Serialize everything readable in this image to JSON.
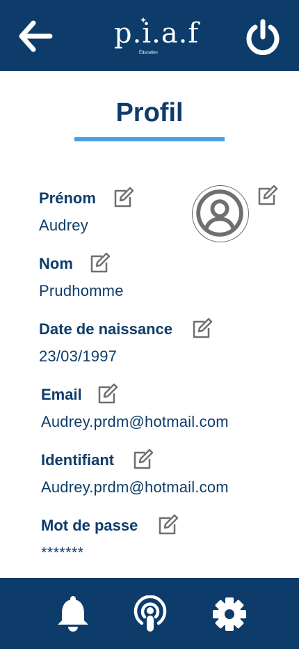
{
  "header": {
    "logo_text": "p.i.a.f",
    "logo_subtitle": "Éducation",
    "back_icon": "arrow-left-icon",
    "power_icon": "power-icon"
  },
  "page": {
    "title": "Profil"
  },
  "profile": {
    "avatar_icon": "user-circle-icon",
    "fields": [
      {
        "label": "Prénom",
        "value": "Audrey"
      },
      {
        "label": "Nom",
        "value": "Prudhomme"
      },
      {
        "label": "Date de naissance",
        "value": "23/03/1997"
      },
      {
        "label": "Email",
        "value": "Audrey.prdm@hotmail.com"
      },
      {
        "label": "Identifiant",
        "value": "Audrey.prdm@hotmail.com"
      },
      {
        "label": "Mot de passe",
        "value": "*******"
      }
    ]
  },
  "bottom_nav": {
    "items": [
      {
        "icon": "bell-icon"
      },
      {
        "icon": "podcast-icon"
      },
      {
        "icon": "gear-icon"
      }
    ]
  },
  "colors": {
    "primary": "#0d3c6b",
    "accent": "#4a9fe4",
    "icon_gray": "#6f6f6f"
  }
}
